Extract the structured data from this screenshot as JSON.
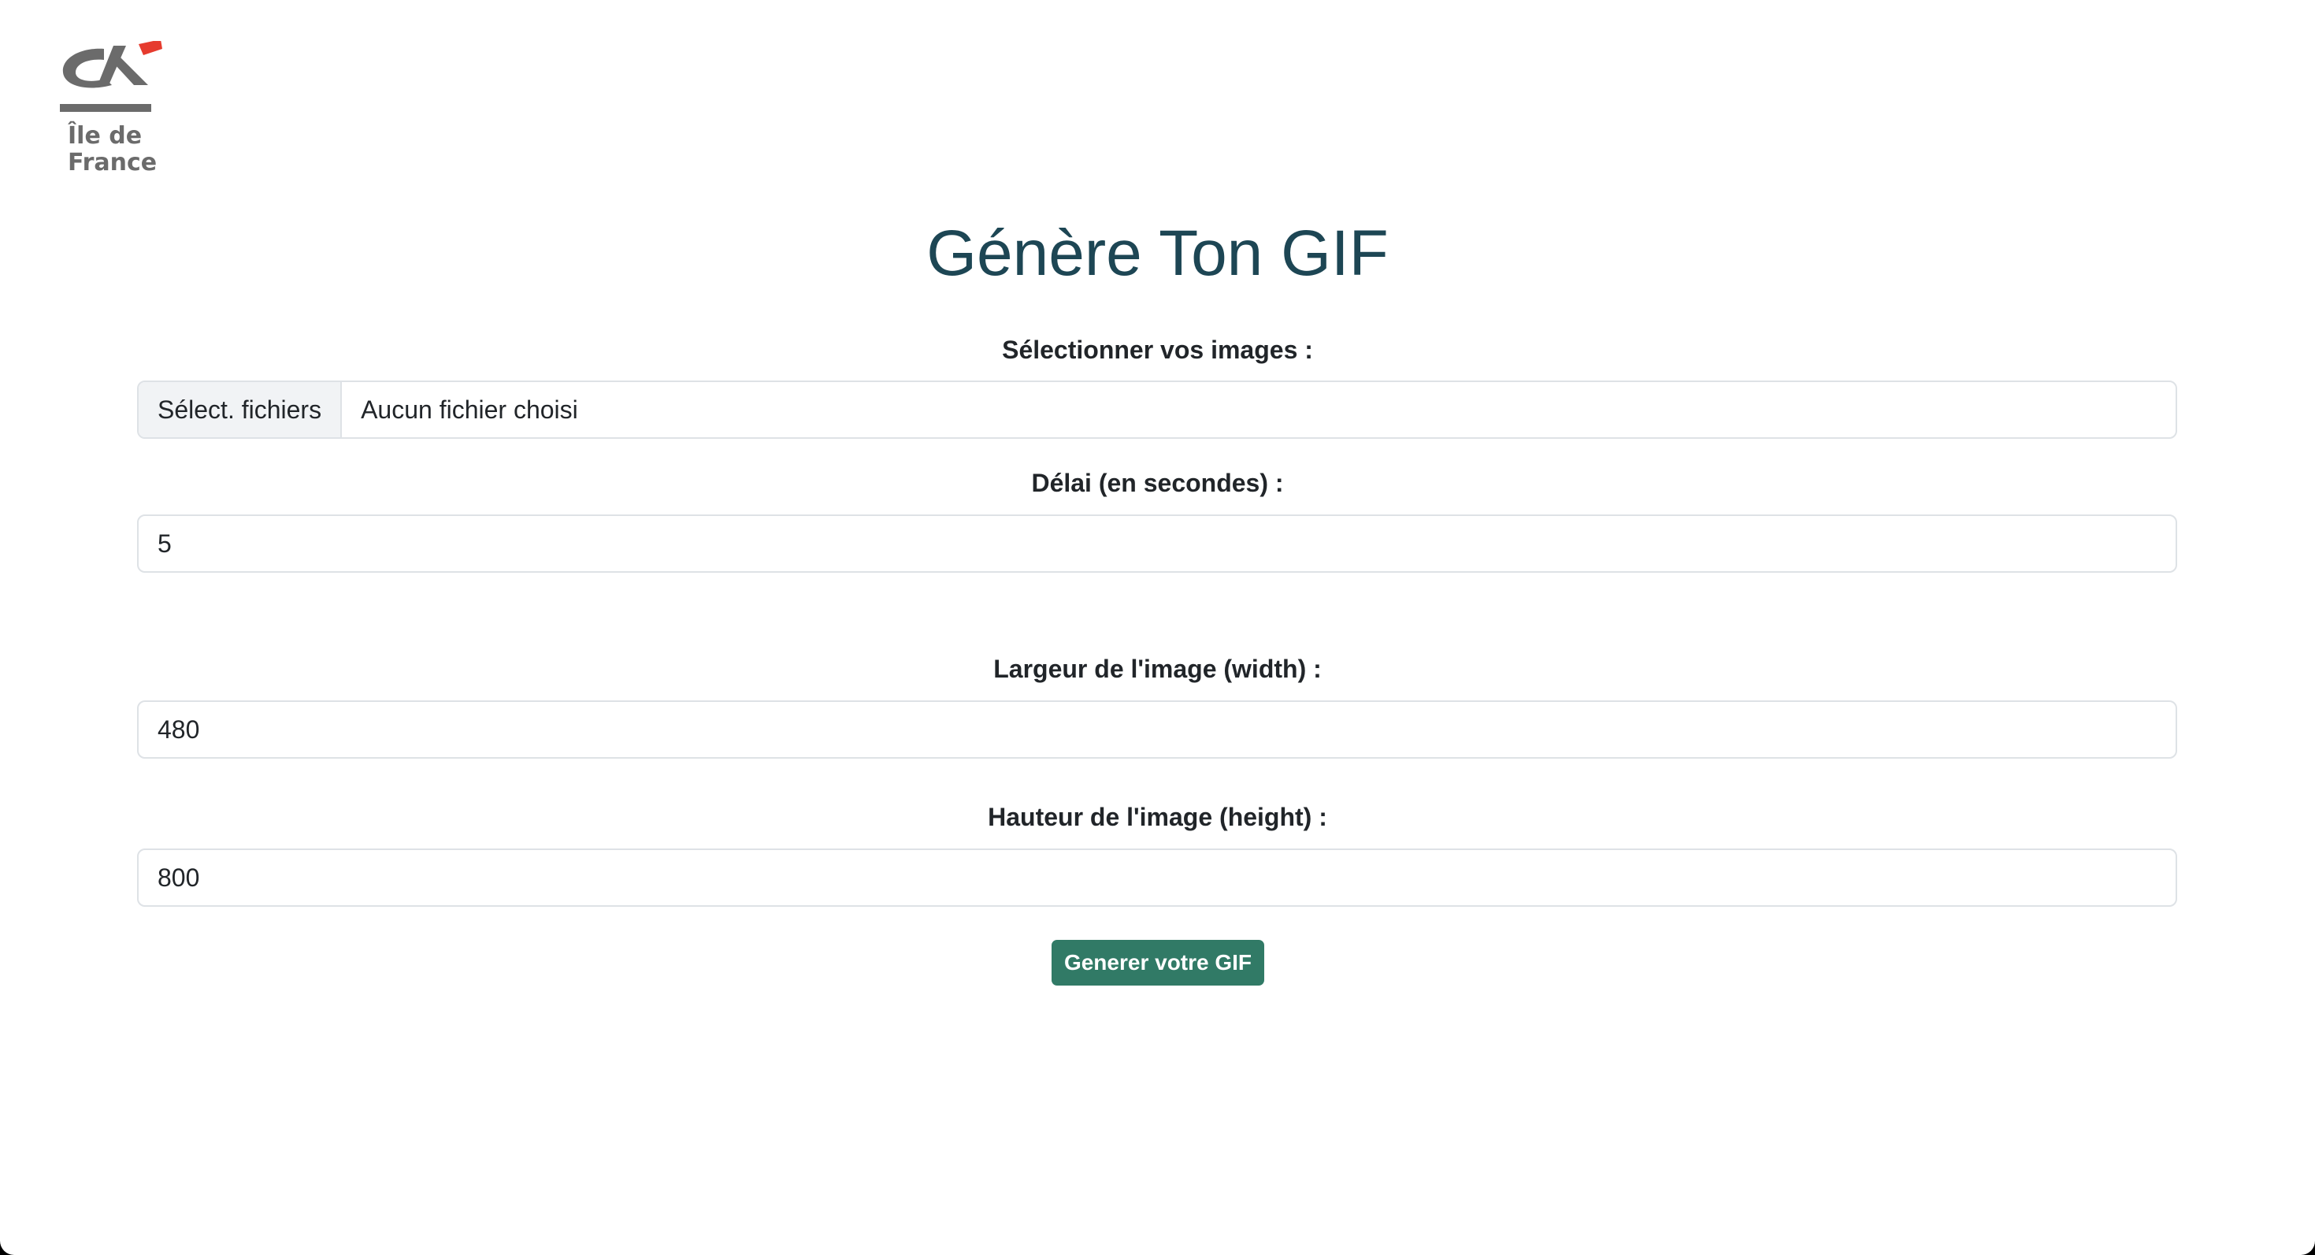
{
  "brand": {
    "logo_text_line1": "Île de",
    "logo_text_line2": "France",
    "logo_gray": "#6b6b6b",
    "logo_red": "#e63b2e"
  },
  "page": {
    "title": "Génère Ton GIF",
    "title_color": "#1d4654"
  },
  "form": {
    "images": {
      "label": "Sélectionner vos images :",
      "button_label": "Sélect. fichiers",
      "status": "Aucun fichier choisi"
    },
    "delay": {
      "label": "Délai (en secondes) :",
      "value": "5"
    },
    "width": {
      "label": "Largeur de l'image (width) :",
      "value": "480"
    },
    "height": {
      "label": "Hauteur de l'image (height) :",
      "value": "800"
    },
    "submit": {
      "label": "Generer votre GIF",
      "color": "#317a66"
    }
  }
}
